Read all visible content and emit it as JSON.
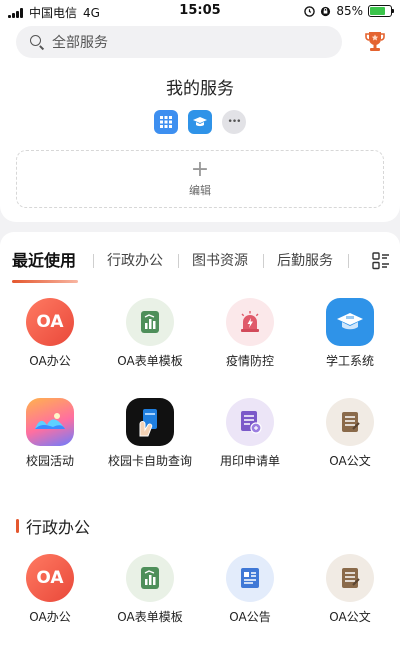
{
  "status_bar": {
    "carrier": "中国电信",
    "network": "4G",
    "time": "15:05",
    "battery_text": "85%",
    "battery_level": 0.85,
    "colors": {
      "battery": "#3bc44b"
    }
  },
  "search": {
    "placeholder": "全部服务"
  },
  "my_services": {
    "title": "我的服务",
    "edit_label": "编辑",
    "edit_symbol": "+",
    "more_symbol": "•••"
  },
  "tabs": [
    {
      "label": "最近使用",
      "active": true
    },
    {
      "label": "行政办公",
      "active": false
    },
    {
      "label": "图书资源",
      "active": false
    },
    {
      "label": "后勤服务",
      "active": false
    }
  ],
  "recent": [
    {
      "label": "OA办公",
      "icon": "oa-badge-icon"
    },
    {
      "label": "OA表单模板",
      "icon": "form-chart-icon"
    },
    {
      "label": "疫情防控",
      "icon": "alarm-light-icon"
    },
    {
      "label": "学工系统",
      "icon": "graduation-cap-icon"
    },
    {
      "label": "校园活动",
      "icon": "landscape-icon"
    },
    {
      "label": "校园卡自助查询",
      "icon": "card-hand-icon"
    },
    {
      "label": "用印申请单",
      "icon": "stamp-document-icon"
    },
    {
      "label": "OA公文",
      "icon": "document-list-icon"
    }
  ],
  "section": {
    "title": "行政办公",
    "items": [
      {
        "label": "OA办公",
        "icon": "oa-badge-icon"
      },
      {
        "label": "OA表单模板",
        "icon": "form-chart-icon"
      },
      {
        "label": "OA公告",
        "icon": "notice-icon"
      },
      {
        "label": "OA公文",
        "icon": "document-list-icon"
      }
    ]
  },
  "badge_text": {
    "oa": "OA"
  },
  "colors": {
    "accent": "#e4572e",
    "oa": "#ef5b45",
    "form": "#4e8f5a",
    "alarm": "#e05a6a",
    "student": "#2f93e8",
    "activity": "#ffb24d",
    "card": "#1f7fe0",
    "stamp": "#7b59c9",
    "document": "#8a6a4a",
    "notice": "#3f78d6"
  }
}
